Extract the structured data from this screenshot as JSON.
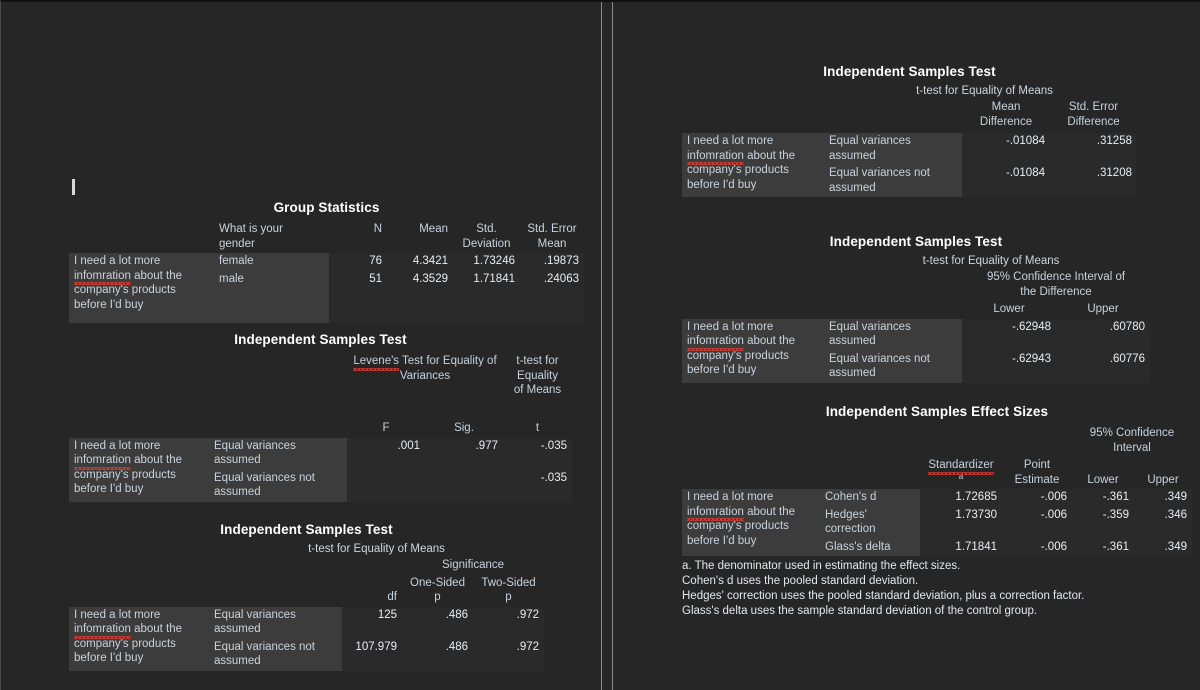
{
  "app": {
    "background": "#262626",
    "stub_background": "#3c3c3c",
    "cell_background": "#2a2a2a",
    "text_color": "#cdd6e0",
    "spellcheck_color": "#e03a2f"
  },
  "row_label": {
    "line1": "I need a lot more",
    "line2_misspelled": "infomration",
    "line2_rest": " about the",
    "line3": "company's products",
    "line4": "before I'd buy"
  },
  "left_panel": {
    "group_statistics": {
      "title": "Group Statistics",
      "headers": {
        "group_var_line1": "What is your",
        "group_var_line2": "gender",
        "n": "N",
        "mean": "Mean",
        "sd_line1": "Std.",
        "sd_line2": "Deviation",
        "sem_line1": "Std. Error",
        "sem_line2": "Mean"
      },
      "rows": [
        {
          "group": "female",
          "n": "76",
          "mean": "4.3421",
          "sd": "1.73246",
          "sem": ".19873"
        },
        {
          "group": "male",
          "n": "51",
          "mean": "4.3529",
          "sd": "1.71841",
          "sem": ".24063"
        }
      ]
    },
    "levene_test": {
      "title": "Independent Samples Test",
      "headers": {
        "levene_misspelled": "Levene's",
        "levene_rest": " Test for Equality of",
        "levene_line2": "Variances",
        "ttest_line1": "t-test for",
        "ttest_line2": "Equality",
        "ttest_line3": "of Means",
        "f": "F",
        "sig": "Sig.",
        "t": "t"
      },
      "rows": [
        {
          "variance_line1": "Equal variances",
          "variance_line2": "assumed",
          "f": ".001",
          "sig": ".977",
          "t": "-.035"
        },
        {
          "variance_line1": "Equal variances not",
          "variance_line2": "assumed",
          "f": "",
          "sig": "",
          "t": "-.035"
        }
      ]
    },
    "significance": {
      "title": "Independent Samples Test",
      "subtitle": "t-test for Equality of Means",
      "headers": {
        "significance": "Significance",
        "df": "df",
        "one_sided_line1": "One-Sided",
        "one_sided_line2": "p",
        "two_sided_line1": "Two-Sided",
        "two_sided_line2": "p"
      },
      "rows": [
        {
          "variance_line1": "Equal variances",
          "variance_line2": "assumed",
          "df": "125",
          "one_sided": ".486",
          "two_sided": ".972"
        },
        {
          "variance_line1": "Equal variances not",
          "variance_line2": "assumed",
          "df": "107.979",
          "one_sided": ".486",
          "two_sided": ".972"
        }
      ]
    }
  },
  "right_panel": {
    "mean_difference": {
      "title": "Independent Samples Test",
      "subtitle": "t-test for Equality of Means",
      "headers": {
        "mean_diff_line1": "Mean",
        "mean_diff_line2": "Difference",
        "se_diff_line1": "Std. Error",
        "se_diff_line2": "Difference"
      },
      "rows": [
        {
          "variance_line1": "Equal variances",
          "variance_line2": "assumed",
          "mean_diff": "-.01084",
          "se_diff": ".31258"
        },
        {
          "variance_line1": "Equal variances not",
          "variance_line2": "assumed",
          "mean_diff": "-.01084",
          "se_diff": ".31208"
        }
      ]
    },
    "confidence_interval": {
      "title": "Independent Samples Test",
      "subtitle": "t-test for Equality of Means",
      "headers": {
        "ci_line1": "95% Confidence Interval of",
        "ci_line2": "the Difference",
        "lower": "Lower",
        "upper": "Upper"
      },
      "rows": [
        {
          "variance_line1": "Equal variances",
          "variance_line2": "assumed",
          "lower": "-.62948",
          "upper": ".60780"
        },
        {
          "variance_line1": "Equal variances not",
          "variance_line2": "assumed",
          "lower": "-.62943",
          "upper": ".60776"
        }
      ]
    },
    "effect_sizes": {
      "title": "Independent Samples Effect Sizes",
      "headers": {
        "standardizer": "Standardizer",
        "standardizer_footnote": "a",
        "point_line1": "Point",
        "point_line2": "Estimate",
        "ci_line1": "95% Confidence",
        "ci_line2": "Interval",
        "lower": "Lower",
        "upper": "Upper"
      },
      "rows": [
        {
          "measure_line1": "Cohen's d",
          "measure_line2": "",
          "standardizer": "1.72685",
          "point": "-.006",
          "lower": "-.361",
          "upper": ".349"
        },
        {
          "measure_line1": "Hedges'",
          "measure_line2": "correction",
          "standardizer": "1.73730",
          "point": "-.006",
          "lower": "-.359",
          "upper": ".346"
        },
        {
          "measure_line1": "Glass's delta",
          "measure_line2": "",
          "standardizer": "1.71841",
          "point": "-.006",
          "lower": "-.361",
          "upper": ".349"
        }
      ],
      "footnotes": [
        "a. The denominator used in estimating the effect sizes.",
        "Cohen's d uses the pooled standard deviation.",
        "Hedges' correction uses the pooled standard deviation, plus a correction factor.",
        "Glass's delta uses the sample standard deviation of the control group."
      ]
    }
  }
}
